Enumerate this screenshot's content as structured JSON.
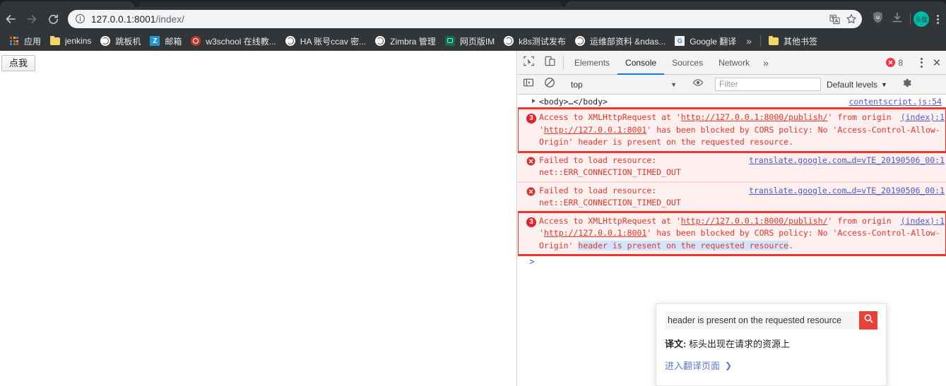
{
  "browser": {
    "nav": {
      "back_icon": "arrow-left-icon",
      "forward_icon": "arrow-right-icon",
      "reload_icon": "reload-icon"
    },
    "omnibox": {
      "info_icon": "info-circle-icon",
      "url_host": "127.0.0.1:8001",
      "url_path": "/index/",
      "translate_icon": "translate-icon",
      "bookmark_icon": "star-icon"
    },
    "toolbar_right": {
      "extension_icon": "shield-extension-icon",
      "download_icon": "download-icon",
      "avatar_label": "头像",
      "menu_icon": "kebab-menu-icon"
    },
    "bookmarks": [
      {
        "icon": "apps-grid-icon",
        "label": "应用"
      },
      {
        "icon": "folder-icon",
        "label": "jenkins"
      },
      {
        "icon": "globe-icon",
        "label": "跳板机"
      },
      {
        "icon": "zimbra-z-icon",
        "label": "邮箱"
      },
      {
        "icon": "w3school-icon",
        "label": "w3school 在线教..."
      },
      {
        "icon": "globe-icon",
        "label": "HA 账号ccav 密..."
      },
      {
        "icon": "globe-icon",
        "label": "Zimbra 管理"
      },
      {
        "icon": "im-icon",
        "label": "网页版IM"
      },
      {
        "icon": "globe-icon",
        "label": "k8s测试发布"
      },
      {
        "icon": "globe-icon",
        "label": "运维部资料 &ndas..."
      },
      {
        "icon": "google-translate-icon",
        "label": "Google 翻译"
      }
    ],
    "bookmarks_overflow_icon": "chevron-double-right-icon",
    "other_bookmarks": {
      "icon": "folder-icon",
      "label": "其他书签"
    }
  },
  "page": {
    "button_label": "点我"
  },
  "devtools": {
    "inspect_icon": "inspect-cursor-icon",
    "device_toggle_icon": "device-toolbar-icon",
    "tabs": [
      {
        "label": "Elements",
        "active": false
      },
      {
        "label": "Console",
        "active": true
      },
      {
        "label": "Sources",
        "active": false
      },
      {
        "label": "Network",
        "active": false
      }
    ],
    "more_tabs_icon": "chevron-double-right-icon",
    "error_count": "8",
    "error_icon": "error-circle-icon",
    "menu_icon": "kebab-menu-icon",
    "close_icon": "close-icon",
    "toolbar2": {
      "sidebar_icon": "console-sidebar-icon",
      "clear_icon": "clear-console-icon",
      "context_value": "top",
      "context_caret": "chevron-down-icon",
      "eye_icon": "live-expression-eye-icon",
      "filter_placeholder": "Filter",
      "filter_value": "",
      "levels_label": "Default levels",
      "levels_caret": "chevron-down-icon",
      "settings_icon": "gear-icon"
    },
    "messages": [
      {
        "kind": "dom",
        "expand_icon": "disclosure-triangle-icon",
        "text": "<body>…</body>",
        "source": "contentscript.js:54"
      },
      {
        "kind": "error",
        "boxed": true,
        "count": "3",
        "source": "(index):1",
        "parts": [
          {
            "t": "Access to XMLHttpRequest at '",
            "style": "plain"
          },
          {
            "t": "http://127.0.0.1:8000/publish/",
            "style": "link"
          },
          {
            "t": "' from origin '",
            "style": "plain"
          },
          {
            "t": "http://127.0.0.1:8001",
            "style": "link"
          },
          {
            "t": "' has been blocked by CORS policy: No 'Access-Control-Allow-Origin' header is present on the requested resource.",
            "style": "plain"
          }
        ]
      },
      {
        "kind": "error",
        "boxed": false,
        "icon": "error-circle-icon",
        "source": "translate.google.com…d=vTE_20190506_00:1",
        "parts": [
          {
            "t": "Failed to load resource:",
            "style": "plain"
          },
          {
            "t": "net::ERR_CONNECTION_TIMED_OUT",
            "style": "plain"
          }
        ]
      },
      {
        "kind": "error",
        "boxed": false,
        "icon": "error-circle-icon",
        "source": "translate.google.com…d=vTE_20190506_00:1",
        "parts": [
          {
            "t": "Failed to load resource:",
            "style": "plain"
          },
          {
            "t": "net::ERR_CONNECTION_TIMED_OUT",
            "style": "plain"
          }
        ]
      },
      {
        "kind": "error",
        "boxed": true,
        "count": "3",
        "source": "(index):1",
        "parts": [
          {
            "t": "Access to XMLHttpRequest at '",
            "style": "plain"
          },
          {
            "t": "http://127.0.0.1:8000/publish/",
            "style": "link"
          },
          {
            "t": "' from origin '",
            "style": "plain"
          },
          {
            "t": "http://127.0.0.1:8001",
            "style": "link"
          },
          {
            "t": "' has been blocked by CORS policy: No 'Access-Control-Allow-Origin' ",
            "style": "plain"
          },
          {
            "t": "header is present on the requested resource",
            "style": "selected"
          },
          {
            "t": ".",
            "style": "plain"
          }
        ]
      }
    ],
    "prompt_caret": ">"
  },
  "translate_popup": {
    "query": "header is present on the requested resource",
    "search_icon": "search-icon",
    "translation_label": "译文:",
    "translation_text": "标头出现在请求的资源上",
    "link_label": "进入翻译页面",
    "link_chevron": "chevron-right-icon"
  },
  "colors": {
    "chrome_bg": "#323639",
    "devtools_accent": "#1a73e8",
    "error_red": "#e6352b",
    "error_box": "#f1342e",
    "error_bg": "#fff0f0",
    "link_blue": "#4b5cc4",
    "selection_blue": "#cfe5fb",
    "translate_red": "#e8413a",
    "avatar_teal": "#00b8a9"
  }
}
